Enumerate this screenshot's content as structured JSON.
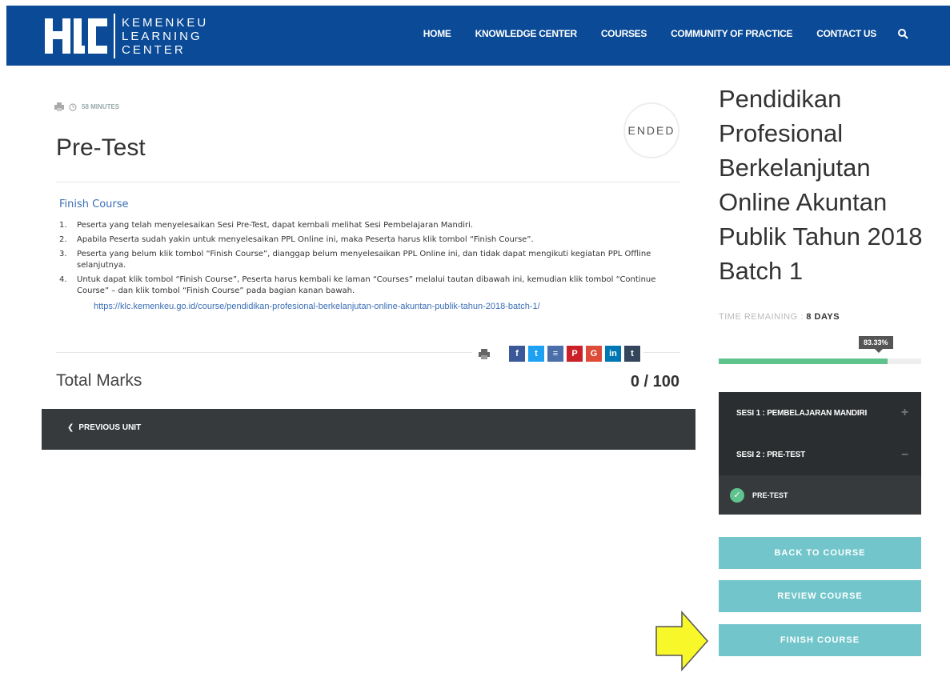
{
  "header": {
    "logo_text_lines": [
      "KEMENKEU",
      "LEARNING",
      "CENTER"
    ],
    "logo_mark": "KLC",
    "nav": [
      "HOME",
      "KNOWLEDGE CENTER",
      "COURSES",
      "COMMUNITY OF PRACTICE",
      "CONTACT US"
    ],
    "search_icon": "search-icon"
  },
  "unit": {
    "duration": "58 MINUTES",
    "status_badge": "ENDED",
    "title": "Pre-Test",
    "finish_heading": "Finish Course",
    "instructions": [
      {
        "num": "1.",
        "html": "Peserta yang telah menyelesaikan Sesi Pre-Test, dapat kembali melihat Sesi Pembelajaran Mandiri."
      },
      {
        "num": "2.",
        "html": "Apabila Peserta sudah yakin untuk menyelesaikan PPL Online ini, maka Peserta harus klik tombol “Finish Course”."
      },
      {
        "num": "3.",
        "html": "Peserta yang belum klik tombol “Finish Course”, dianggap belum menyelesaikan PPL Online ini, dan tidak dapat mengikuti kegiatan PPL Offline selanjutnya."
      },
      {
        "num": "4.",
        "html": "Untuk dapat klik tombol “Finish Course”, Peserta harus kembali ke laman “Courses” melalui tautan dibawah ini, kemudian klik tombol “Continue Course” – dan klik tombol “Finish Course” pada bagian kanan bawah."
      }
    ],
    "link": "https://klc.kemenkeu.go.id/course/pendidikan-profesional-berkelanjutan-online-akuntan-publik-tahun-2018-batch-1/",
    "share": [
      {
        "label": "f",
        "color": "#3b5998",
        "icon": "facebook-icon"
      },
      {
        "label": "t",
        "color": "#1da1f2",
        "icon": "twitter-icon"
      },
      {
        "label": "≡",
        "color": "#4a6ea9",
        "icon": "buffer-icon"
      },
      {
        "label": "P",
        "color": "#cb2027",
        "icon": "pinterest-icon"
      },
      {
        "label": "G",
        "color": "#dd4b39",
        "icon": "google-icon"
      },
      {
        "label": "in",
        "color": "#0077b5",
        "icon": "linkedin-icon"
      },
      {
        "label": "t",
        "color": "#35465c",
        "icon": "tumblr-icon"
      }
    ],
    "total_marks_label": "Total Marks",
    "total_marks_value": "0 / 100",
    "prev_unit": "PREVIOUS UNIT"
  },
  "sidebar": {
    "course_title": "Pendidikan Profesional Berkelanjutan Online Akuntan Publik Tahun 2018 Batch 1",
    "time_remaining_label": "TIME REMAINING :",
    "time_remaining_value": "8 DAYS",
    "progress_text": "83.33%",
    "progress_fraction": 0.8333,
    "sections": [
      {
        "label": "SESI 1 : PEMBELAJARAN MANDIRI",
        "toggle": "+"
      },
      {
        "label": "SESI 2 : PRE-TEST",
        "toggle": "–"
      }
    ],
    "sub_item": "PRE-TEST",
    "buttons": [
      "BACK TO COURSE",
      "REVIEW COURSE",
      "FINISH COURSE"
    ],
    "colors": {
      "button": "#72c6cb",
      "progress": "#5fc38e",
      "header": "#0a4a96",
      "annotation_arrow": "#f7f72a"
    }
  }
}
